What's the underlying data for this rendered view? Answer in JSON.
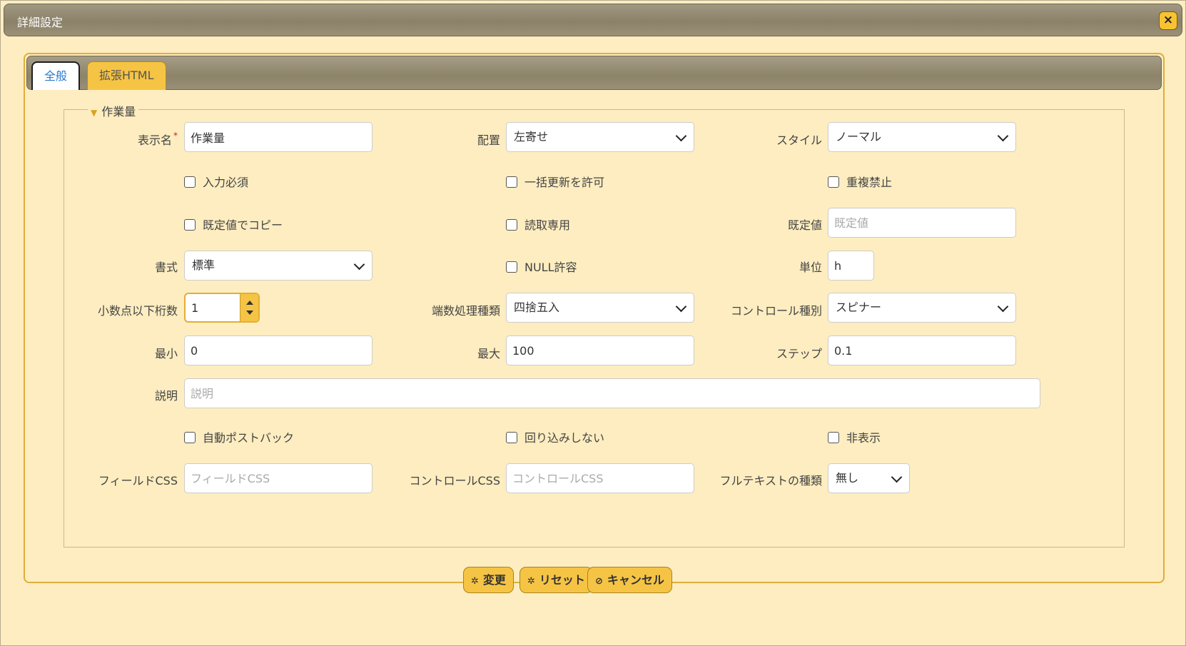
{
  "dialog": {
    "title": "詳細設定",
    "close_icon": "×"
  },
  "tabs": [
    {
      "label": "全般"
    },
    {
      "label": "拡張HTML"
    }
  ],
  "group": {
    "title": "作業量"
  },
  "fields": {
    "display_name": {
      "label": "表示名",
      "required_mark": "*",
      "value": "作業量"
    },
    "alignment": {
      "label": "配置",
      "value": "左寄せ"
    },
    "style": {
      "label": "スタイル",
      "value": "ノーマル"
    },
    "required": {
      "label": "入力必須",
      "checked": false
    },
    "bulk_update": {
      "label": "一括更新を許可",
      "checked": false
    },
    "no_duplicate": {
      "label": "重複禁止",
      "checked": false
    },
    "copy_default": {
      "label": "既定値でコピー",
      "checked": false
    },
    "read_only": {
      "label": "読取専用",
      "checked": false
    },
    "default_value": {
      "label": "既定値",
      "placeholder": "既定値"
    },
    "format": {
      "label": "書式",
      "value": "標準"
    },
    "null_allowed": {
      "label": "NULL許容",
      "checked": false
    },
    "unit": {
      "label": "単位",
      "value": "h"
    },
    "decimal_places": {
      "label": "小数点以下桁数",
      "value": "1"
    },
    "rounding": {
      "label": "端数処理種類",
      "value": "四捨五入"
    },
    "control_type": {
      "label": "コントロール種別",
      "value": "スピナー"
    },
    "min": {
      "label": "最小",
      "value": "0"
    },
    "max": {
      "label": "最大",
      "value": "100"
    },
    "step": {
      "label": "ステップ",
      "value": "0.1"
    },
    "description": {
      "label": "説明",
      "placeholder": "説明"
    },
    "auto_postback": {
      "label": "自動ポストバック",
      "checked": false
    },
    "no_wrap": {
      "label": "回り込みしない",
      "checked": false
    },
    "hidden": {
      "label": "非表示",
      "checked": false
    },
    "field_css": {
      "label": "フィールドCSS",
      "placeholder": "フィールドCSS"
    },
    "control_css": {
      "label": "コントロールCSS",
      "placeholder": "コントロールCSS"
    },
    "fulltext_type": {
      "label": "フルテキストの種類",
      "value": "無し"
    }
  },
  "buttons": {
    "change": {
      "label": "変更",
      "icon": "gear-icon"
    },
    "reset": {
      "label": "リセット",
      "icon": "gear-icon"
    },
    "cancel": {
      "label": "キャンセル",
      "icon": "cancel-icon"
    }
  },
  "colors": {
    "background": "#fdedc0",
    "accent": "#f6c444",
    "titlebar": "#8b8168",
    "active_tab_text": "#2a7bd0"
  }
}
